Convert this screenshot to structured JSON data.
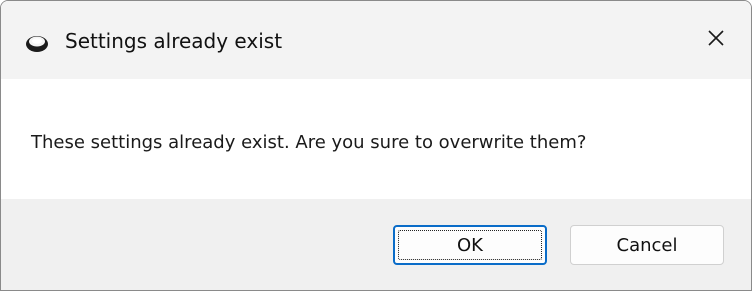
{
  "dialog": {
    "title": "Settings already exist",
    "title_icon": "app-disc-icon",
    "close_icon": "close-icon",
    "message": "These settings already exist. Are you sure to overwrite them?",
    "buttons": {
      "ok_label": "OK",
      "cancel_label": "Cancel"
    }
  },
  "colors": {
    "titlebar_bg": "#f3f3f3",
    "content_bg": "#ffffff",
    "footer_bg": "#f0f0f0",
    "focus_accent": "#0a6cc8"
  }
}
